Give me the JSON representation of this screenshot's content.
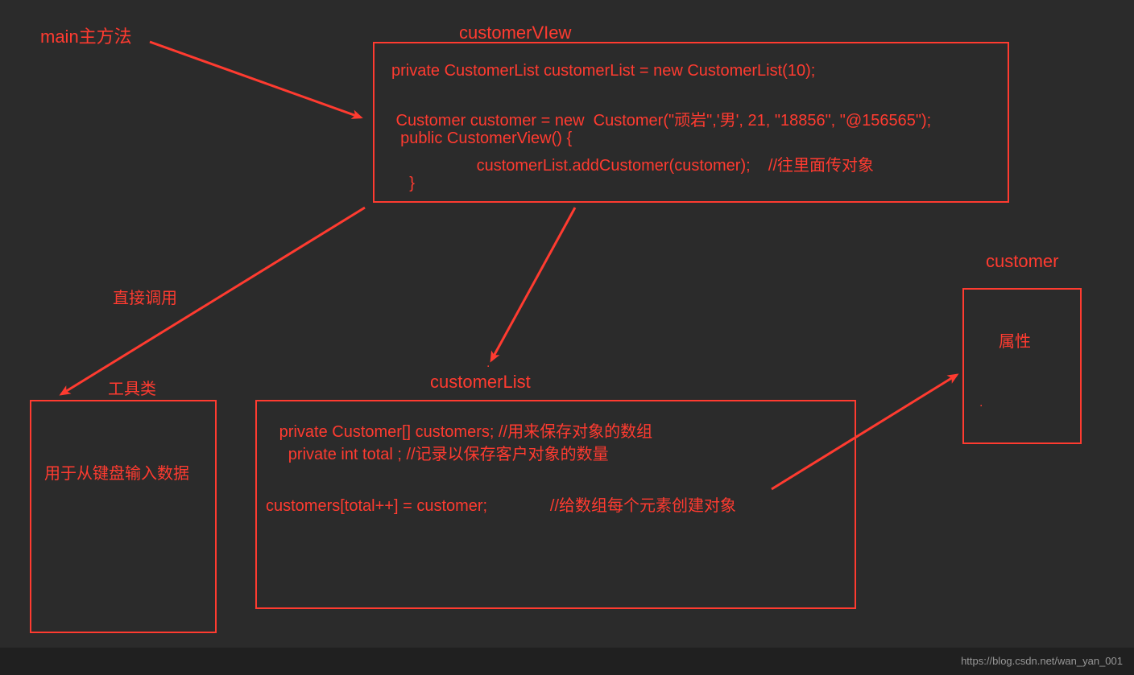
{
  "labels": {
    "main": "main主方法",
    "customerView": "customerVIew",
    "directCall": "直接调用",
    "util": "工具类",
    "customerList": "customerList",
    "customer": "customer",
    "utilBody": "用于从键盘输入数据",
    "attr": "属性"
  },
  "code": {
    "cv1": "private CustomerList customerList = new CustomerList(10);",
    "cv2": " Customer customer = new  Customer(\"顽岩\",'男', 21, \"18856\", \"@156565\");",
    "cv3": "  public CustomerView() {",
    "cv4": "                   customerList.addCustomer(customer);    //往里面传对象",
    "cv5": "    }",
    "cl1": "   private Customer[] customers; //用来保存对象的数组",
    "cl2": "     private int total ; //记录以保存客户对象的数量",
    "cl3": "customers[total++] = customer;              //给数组每个元素创建对象"
  },
  "icons": {
    "dot": "."
  },
  "footer": "https://blog.csdn.net/wan_yan_001"
}
